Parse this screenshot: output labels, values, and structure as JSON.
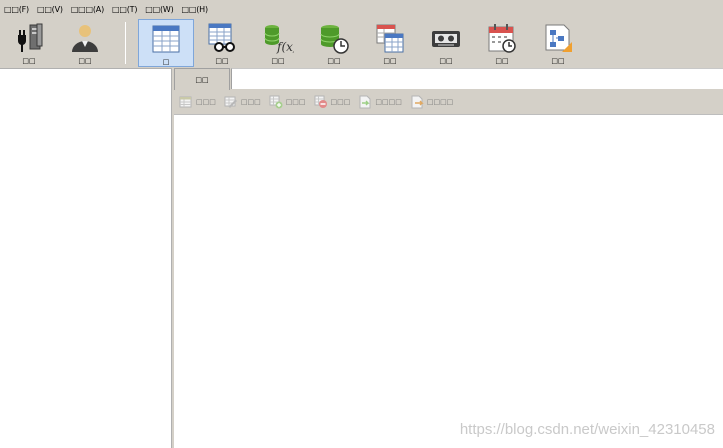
{
  "menu": [
    {
      "label": "□□(F)"
    },
    {
      "label": "□□(V)"
    },
    {
      "label": "□□□(A)"
    },
    {
      "label": "□□(T)"
    },
    {
      "label": "□□(W)"
    },
    {
      "label": "□□(H)"
    }
  ],
  "toolbar": {
    "items": [
      {
        "label": "□□",
        "icon": "connection-icon"
      },
      {
        "label": "□□",
        "icon": "user-icon"
      },
      {
        "label": "□",
        "icon": "table-icon",
        "active": true
      },
      {
        "label": "□□",
        "icon": "view-icon"
      },
      {
        "label": "□□",
        "icon": "function-icon"
      },
      {
        "label": "□□",
        "icon": "event-icon"
      },
      {
        "label": "□□",
        "icon": "query-icon"
      },
      {
        "label": "□□",
        "icon": "backup-icon"
      },
      {
        "label": "□□",
        "icon": "schedule-icon"
      },
      {
        "label": "□□",
        "icon": "model-icon"
      }
    ]
  },
  "main": {
    "tab_label": "□□",
    "object_toolbar": [
      {
        "label": "□□□",
        "icon": "open-table-icon"
      },
      {
        "label": "□□□",
        "icon": "design-table-icon"
      },
      {
        "label": "□□□",
        "icon": "new-table-icon"
      },
      {
        "label": "□□□",
        "icon": "delete-table-icon"
      },
      {
        "label": "□□□□",
        "icon": "import-wizard-icon"
      },
      {
        "label": "□□□□",
        "icon": "export-wizard-icon"
      }
    ]
  },
  "watermark": "https://blog.csdn.net/weixin_42310458",
  "colors": {
    "background": "#d4d0c8",
    "active_button": "#cde0f7",
    "active_border": "#7fa6d9",
    "panel": "#ffffff"
  }
}
